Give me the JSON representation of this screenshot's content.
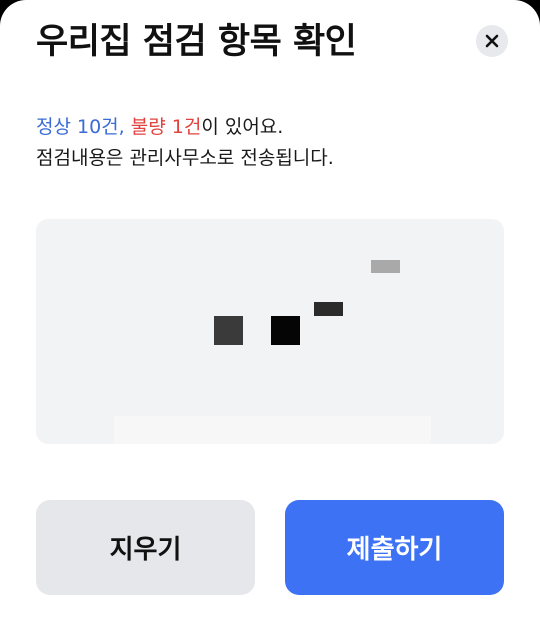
{
  "dialog": {
    "title": "우리집 점검 항목 확인",
    "close_icon": "close-icon"
  },
  "summary": {
    "normal_label": "정상 10건,",
    "defect_label": "불량 1건",
    "suffix": "이 있어요.",
    "line2": "점검내용은 관리사무소로 전송됩니다."
  },
  "colors": {
    "normal": "#3a6bd6",
    "defect": "#e0433f",
    "primary": "#3d72f5",
    "secondary_bg": "#e6e7eb",
    "pad_bg": "#f2f3f5"
  },
  "buttons": {
    "clear_label": "지우기",
    "submit_label": "제출하기"
  }
}
